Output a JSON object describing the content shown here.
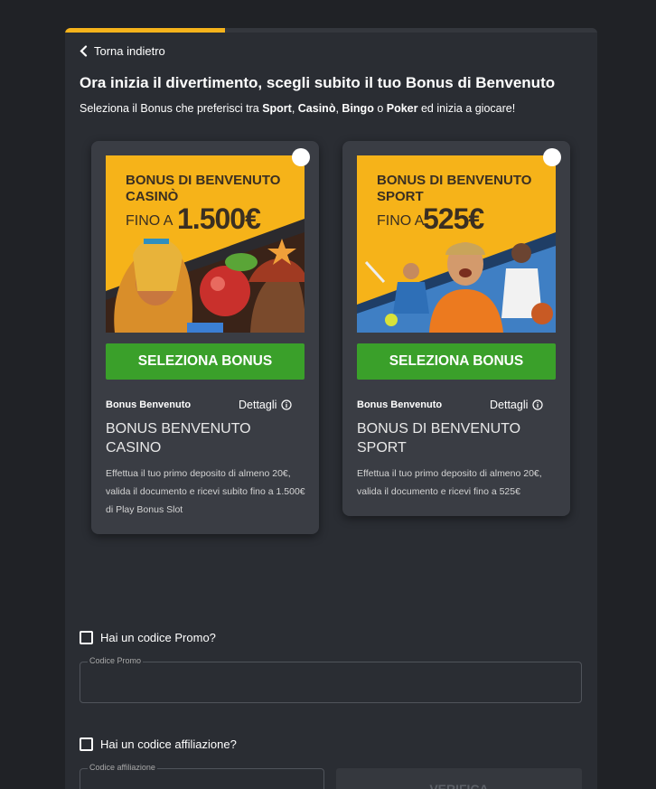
{
  "progress": {
    "fraction": 0.3
  },
  "nav": {
    "back_label": "Torna indietro"
  },
  "header": {
    "title": "Ora inizia il divertimento, scegli subito il tuo Bonus di Benvenuto",
    "subtitle_prefix": "Seleziona il Bonus che preferisci tra ",
    "subtitle_sport": "Sport",
    "subtitle_comma1": ", ",
    "subtitle_casino": "Casinò",
    "subtitle_comma2": ", ",
    "subtitle_bingo": "Bingo",
    "subtitle_or": " o ",
    "subtitle_poker": "Poker",
    "subtitle_suffix": " ed inizia a giocare!"
  },
  "cards": [
    {
      "banner_line1": "BONUS DI BENVENUTO",
      "banner_line2": "CASINÒ",
      "banner_fino": "FINO A",
      "banner_amount": "1.500€",
      "select_label": "SELEZIONA BONUS",
      "tag": "Bonus Benvenuto",
      "details_label": "Dettagli",
      "name": "BONUS BENVENUTO CASINO",
      "description": "Effettua il tuo primo deposito di almeno 20€, valida il documento e ricevi subito fino a 1.500€ di Play Bonus Slot"
    },
    {
      "banner_line1": "BONUS DI BENVENUTO",
      "banner_line2": "SPORT",
      "banner_fino": "FINO A",
      "banner_amount": "525€",
      "select_label": "SELEZIONA BONUS",
      "tag": "Bonus Benvenuto",
      "details_label": "Dettagli",
      "name": "BONUS DI BENVENUTO SPORT",
      "description": "Effettua il tuo primo deposito di almeno 20€, valida il documento e ricevi fino a 525€"
    }
  ],
  "promo": {
    "checkbox_label": "Hai un codice Promo?",
    "field_label": "Codice Promo"
  },
  "affiliate": {
    "checkbox_label": "Hai un codice affiliazione?",
    "field_label": "Codice affiliazione",
    "verify_label": "VERIFICA"
  },
  "colors": {
    "accent": "#f5b31b",
    "button_green": "#3aa02a",
    "panel": "#2a2d33",
    "card": "#3a3d44"
  }
}
